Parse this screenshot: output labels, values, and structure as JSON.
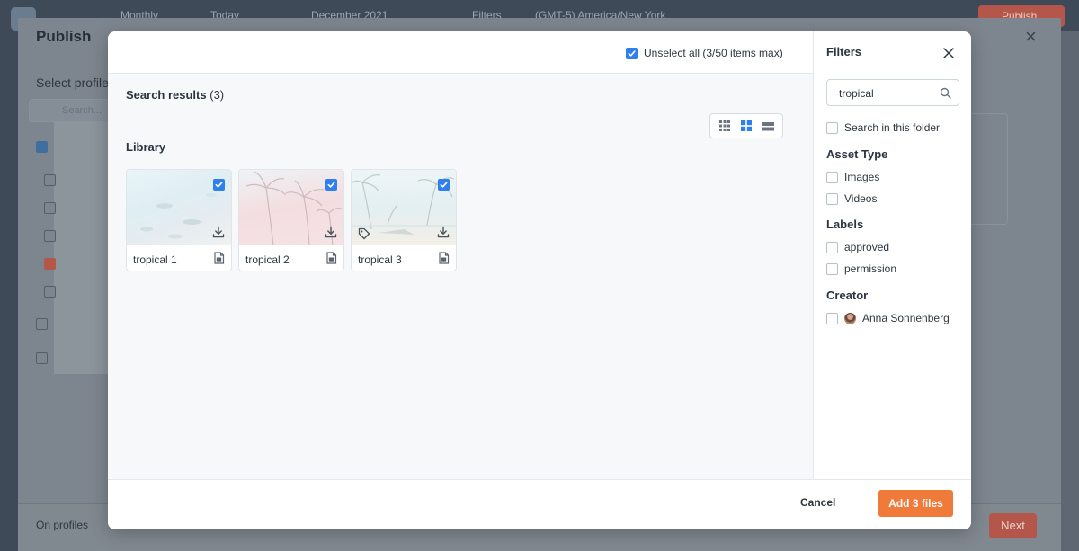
{
  "background": {
    "topbar": {
      "view_label": "Monthly",
      "today_label": "Today",
      "month_label": "December 2021",
      "filters_label": "Filters",
      "timezone_label": "(GMT-5) America/New York",
      "publish_label": "Publish"
    },
    "panel": {
      "title": "Publish",
      "subtitle": "Select profile",
      "search_placeholder": "Search...",
      "on_profiles_label": "On profiles",
      "next_label": "Next"
    }
  },
  "modal": {
    "unselect_all_label": "Unselect all (3/50 items max)",
    "results_title": "Search results",
    "results_count": "(3)",
    "library_title": "Library",
    "view_modes": [
      "small-grid-icon",
      "large-grid-icon",
      "list-view-icon"
    ],
    "active_view": "large-grid-icon",
    "items": [
      {
        "name": "tropical 1",
        "selected": true,
        "has_tag": false
      },
      {
        "name": "tropical 2",
        "selected": true,
        "has_tag": false
      },
      {
        "name": "tropical 3",
        "selected": true,
        "has_tag": true
      }
    ],
    "footer": {
      "cancel_label": "Cancel",
      "add_label": "Add 3 files"
    }
  },
  "filters": {
    "title": "Filters",
    "search_value": "tropical",
    "search_in_folder_label": "Search in this folder",
    "asset_type_heading": "Asset Type",
    "asset_types": [
      "Images",
      "Videos"
    ],
    "labels_heading": "Labels",
    "labels": [
      "approved",
      "permission"
    ],
    "creator_heading": "Creator",
    "creators": [
      "Anna Sonnenberg"
    ]
  },
  "colors": {
    "accent_blue": "#2f80ed",
    "primary_orange": "#f07a3a",
    "overlay": "#5f6872"
  }
}
